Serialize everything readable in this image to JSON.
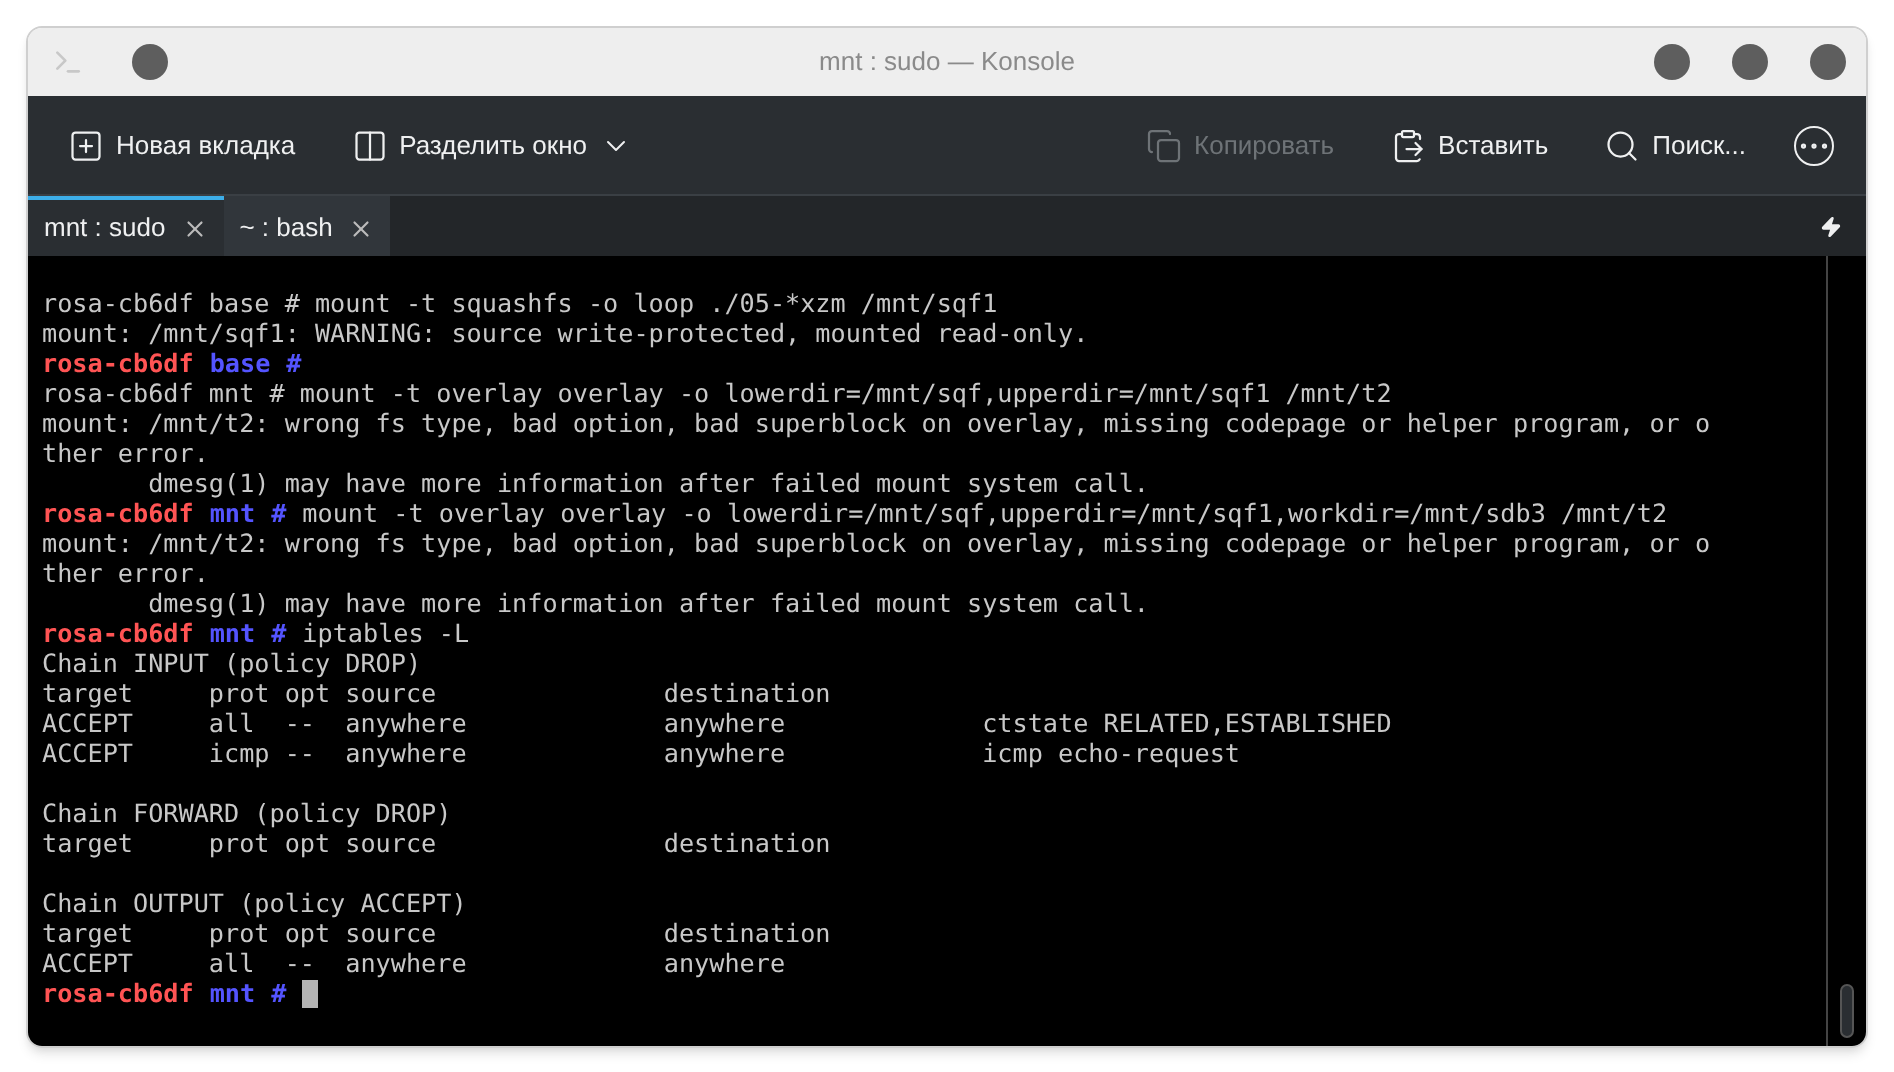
{
  "window": {
    "title": "mnt : sudo — Konsole"
  },
  "toolbar": {
    "left": [
      {
        "kind": "new-tab",
        "label": "Новая вкладка",
        "disabled": false
      },
      {
        "kind": "split",
        "label": "Разделить окно",
        "disabled": false
      }
    ],
    "right": [
      {
        "kind": "copy",
        "label": "Копировать",
        "disabled": true
      },
      {
        "kind": "paste",
        "label": "Вставить",
        "disabled": false
      },
      {
        "kind": "search",
        "label": "Поиск...",
        "disabled": false
      }
    ]
  },
  "tabs": [
    {
      "label": "mnt : sudo",
      "selected": true
    },
    {
      "label": "~ : bash",
      "selected": false
    }
  ],
  "terminal": {
    "lines": [
      {
        "kind": "text",
        "text": "rosa-cb6df base # mount -t squashfs -o loop ./05-*xzm /mnt/sqf1"
      },
      {
        "kind": "text",
        "text": "mount: /mnt/sqf1: WARNING: source write-protected, mounted read-only."
      },
      {
        "kind": "prompt",
        "host": "rosa-cb6df",
        "dir": "base",
        "symbol": "#"
      },
      {
        "kind": "text",
        "text": "rosa-cb6df mnt # mount -t overlay overlay -o lowerdir=/mnt/sqf,upperdir=/mnt/sqf1 /mnt/t2"
      },
      {
        "kind": "text",
        "text": "mount: /mnt/t2: wrong fs type, bad option, bad superblock on overlay, missing codepage or helper program, or o"
      },
      {
        "kind": "text",
        "text": "ther error."
      },
      {
        "kind": "text",
        "text": "       dmesg(1) may have more information after failed mount system call."
      },
      {
        "kind": "prompt",
        "host": "rosa-cb6df",
        "dir": "mnt",
        "symbol": "#",
        "command": "mount -t overlay overlay -o lowerdir=/mnt/sqf,upperdir=/mnt/sqf1,workdir=/mnt/sdb3 /mnt/t2"
      },
      {
        "kind": "text",
        "text": "mount: /mnt/t2: wrong fs type, bad option, bad superblock on overlay, missing codepage or helper program, or o"
      },
      {
        "kind": "text",
        "text": "ther error."
      },
      {
        "kind": "text",
        "text": "       dmesg(1) may have more information after failed mount system call."
      },
      {
        "kind": "prompt",
        "host": "rosa-cb6df",
        "dir": "mnt",
        "symbol": "#",
        "command": "iptables -L"
      },
      {
        "kind": "text",
        "text": "Chain INPUT (policy DROP)"
      },
      {
        "kind": "text",
        "text": "target     prot opt source               destination"
      },
      {
        "kind": "text",
        "text": "ACCEPT     all  --  anywhere             anywhere             ctstate RELATED,ESTABLISHED"
      },
      {
        "kind": "text",
        "text": "ACCEPT     icmp --  anywhere             anywhere             icmp echo-request"
      },
      {
        "kind": "blank"
      },
      {
        "kind": "text",
        "text": "Chain FORWARD (policy DROP)"
      },
      {
        "kind": "text",
        "text": "target     prot opt source               destination"
      },
      {
        "kind": "blank"
      },
      {
        "kind": "text",
        "text": "Chain OUTPUT (policy ACCEPT)"
      },
      {
        "kind": "text",
        "text": "target     prot opt source               destination"
      },
      {
        "kind": "text",
        "text": "ACCEPT     all  --  anywhere             anywhere"
      },
      {
        "kind": "prompt",
        "host": "rosa-cb6df",
        "dir": "mnt",
        "symbol": "#",
        "cursor": true
      }
    ]
  }
}
